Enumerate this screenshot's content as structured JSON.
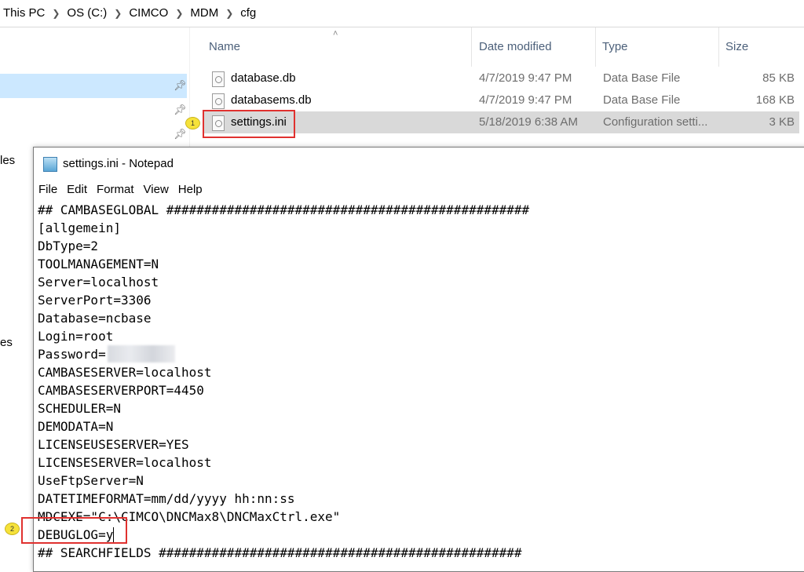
{
  "explorer": {
    "breadcrumb": [
      "This PC",
      "OS (C:)",
      "CIMCO",
      "MDM",
      "cfg"
    ],
    "columns": {
      "name": "Name",
      "date": "Date modified",
      "type": "Type",
      "size": "Size"
    },
    "nav_fragments": [
      "les",
      "es"
    ],
    "files": [
      {
        "name": "database.db",
        "date": "4/7/2019 9:47 PM",
        "type": "Data Base File",
        "size": "85 KB",
        "selected": false
      },
      {
        "name": "databasems.db",
        "date": "4/7/2019 9:47 PM",
        "type": "Data Base File",
        "size": "168 KB",
        "selected": false
      },
      {
        "name": "settings.ini",
        "date": "5/18/2019 6:38 AM",
        "type": "Configuration setti...",
        "size": "3 KB",
        "selected": true
      }
    ]
  },
  "notepad": {
    "title": "settings.ini - Notepad",
    "menu": [
      "File",
      "Edit",
      "Format",
      "View",
      "Help"
    ],
    "lines": [
      "## CAMBASEGLOBAL ################################################",
      "[allgemein]",
      "DbType=2",
      "TOOLMANAGEMENT=N",
      "Server=localhost",
      "ServerPort=3306",
      "Database=ncbase",
      "Login=root",
      "Password=",
      "CAMBASESERVER=localhost",
      "CAMBASESERVERPORT=4450",
      "SCHEDULER=N",
      "DEMODATA=N",
      "LICENSEUSESERVER=YES",
      "LICENSESERVER=localhost",
      "UseFtpServer=N",
      "DATETIMEFORMAT=mm/dd/yyyy hh:nn:ss",
      "MDCEXE=\"C:\\CIMCO\\DNCMax8\\DNCMaxCtrl.exe\"",
      "DEBUGLOG=y",
      "## SEARCHFIELDS ################################################"
    ]
  },
  "annotations": {
    "badge1": "1",
    "badge2": "2"
  },
  "colors": {
    "highlight_box": "#e0312f",
    "badge": "#f6e23a",
    "selection": "#d9d9d9",
    "nav_selected": "#cce8ff"
  }
}
